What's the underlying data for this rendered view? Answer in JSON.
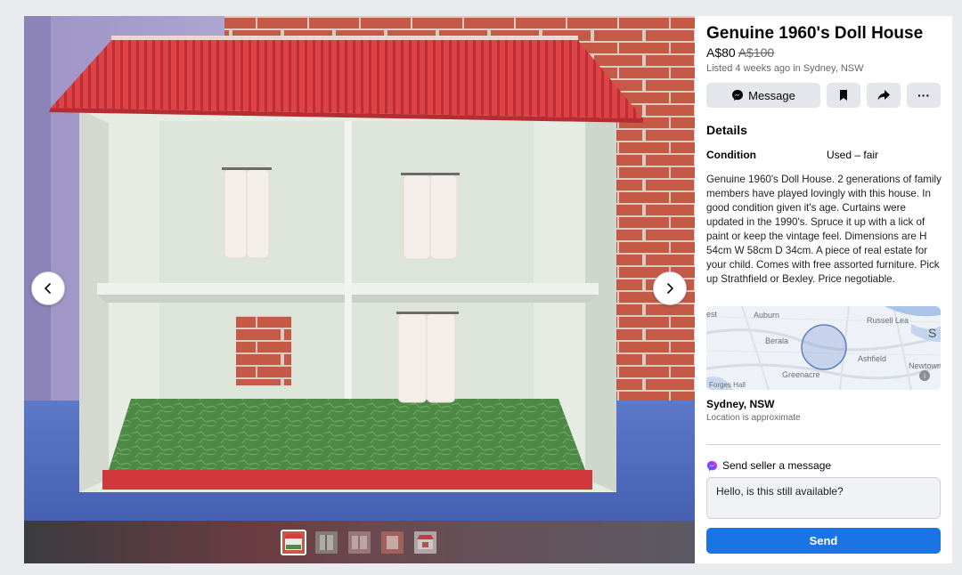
{
  "listing": {
    "title": "Genuine 1960's Doll House",
    "price": "A$80",
    "original_price": "A$100",
    "listed": "Listed 4 weeks ago in Sydney, NSW"
  },
  "actions": {
    "message_label": "Message",
    "save_icon": "bookmark-icon",
    "share_icon": "share-arrow-icon",
    "more_label": "···"
  },
  "details": {
    "heading": "Details",
    "condition_label": "Condition",
    "condition_value": "Used – fair",
    "description": "Genuine 1960's Doll House. 2 generations of family members have played lovingly with this house. In good condition given it's age. Curtains were updated in the 1990's. Spruce it up with a lick of paint or keep the vintage feel. Dimensions are H 54cm W 58cm D 34cm. A piece of real estate for your child. Comes with free assorted furniture. Pick up Strathfield or Bexley. Price negotiable."
  },
  "map": {
    "labels": [
      "Auburn",
      "Russell Lea",
      "Berala",
      "Ashfield",
      "Greenacre",
      "Newtown",
      "est",
      "S",
      "Forges Hall"
    ]
  },
  "location": {
    "city": "Sydney, NSW",
    "note": "Location is approximate"
  },
  "messaging": {
    "heading": "Send seller a message",
    "input_value": "Hello, is this still available?",
    "send_label": "Send"
  },
  "viewer": {
    "prev_icon": "chevron-left-icon",
    "next_icon": "chevron-right-icon",
    "thumbnail_count": 5,
    "active_thumbnail": 1
  },
  "colors": {
    "accent": "#1b74e4",
    "roof": "#d93a3f",
    "floor": "#4f8a47",
    "brick": "#b44d3e"
  }
}
